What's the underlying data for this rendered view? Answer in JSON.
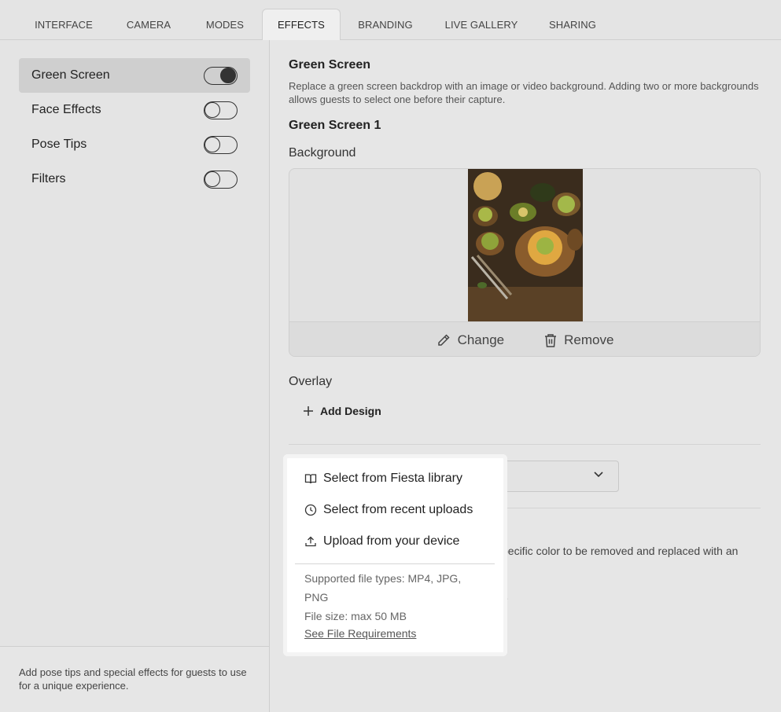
{
  "tabs": [
    {
      "label": "INTERFACE",
      "active": false
    },
    {
      "label": "CAMERA",
      "active": false
    },
    {
      "label": "MODES",
      "active": false
    },
    {
      "label": "EFFECTS",
      "active": true
    },
    {
      "label": "BRANDING",
      "active": false
    },
    {
      "label": "LIVE GALLERY",
      "active": false
    },
    {
      "label": "SHARING",
      "active": false
    }
  ],
  "sidebar": {
    "items": [
      {
        "label": "Green Screen",
        "enabled": true,
        "active": true
      },
      {
        "label": "Face Effects",
        "enabled": false,
        "active": false
      },
      {
        "label": "Pose Tips",
        "enabled": false,
        "active": false
      },
      {
        "label": "Filters",
        "enabled": false,
        "active": false
      }
    ],
    "footer": "Add pose tips and special effects for guests to use for a unique experience."
  },
  "main": {
    "title": "Green Screen",
    "description": "Replace a green screen backdrop with an image or video background. Adding two or more backgrounds allows guests to select one before their capture.",
    "subtitle": "Green Screen 1",
    "background_label": "Background",
    "change_label": "Change",
    "remove_label": "Remove",
    "overlay_label": "Overlay",
    "add_design_label": "Add Design",
    "partial_text_1": "pecific color to be removed and replaced with an",
    "partial_text_2": "e"
  },
  "popup": {
    "items": [
      {
        "label": "Select from Fiesta library",
        "icon": "book-icon"
      },
      {
        "label": "Select from recent uploads",
        "icon": "clock-icon"
      },
      {
        "label": "Upload from your device",
        "icon": "upload-icon"
      }
    ],
    "supported_types_line1": "Supported file types: MP4, JPG,",
    "supported_types_line2": "PNG",
    "file_size": "File size: max 50 MB",
    "link": "See File Requirements"
  }
}
